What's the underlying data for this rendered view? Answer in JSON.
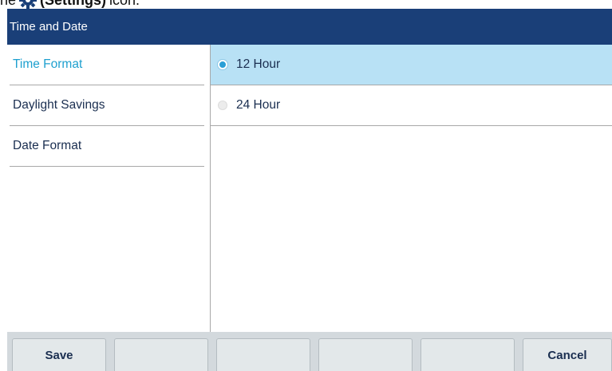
{
  "caption": {
    "prefix": "he",
    "icon": "gear-icon",
    "bold_text": "(Settings)",
    "suffix": "icon."
  },
  "window": {
    "title": "Time and Date"
  },
  "menu": {
    "items": [
      {
        "label": "Time Format",
        "selected": true
      },
      {
        "label": "Daylight Savings",
        "selected": false
      },
      {
        "label": "Date Format",
        "selected": false
      }
    ]
  },
  "options": {
    "items": [
      {
        "label": "12 Hour",
        "selected": true
      },
      {
        "label": "24 Hour",
        "selected": false
      }
    ]
  },
  "softkeys": {
    "keys": [
      {
        "label": "Save"
      },
      {
        "label": ""
      },
      {
        "label": ""
      },
      {
        "label": ""
      },
      {
        "label": ""
      },
      {
        "label": "Cancel"
      }
    ]
  },
  "colors": {
    "title_bar": "#1a3f78",
    "selected_text": "#1ea0cf",
    "selected_row": "#b8e1f5",
    "radio_on": "#2a9fd6",
    "softkey_bar": "#d3d9dd"
  }
}
